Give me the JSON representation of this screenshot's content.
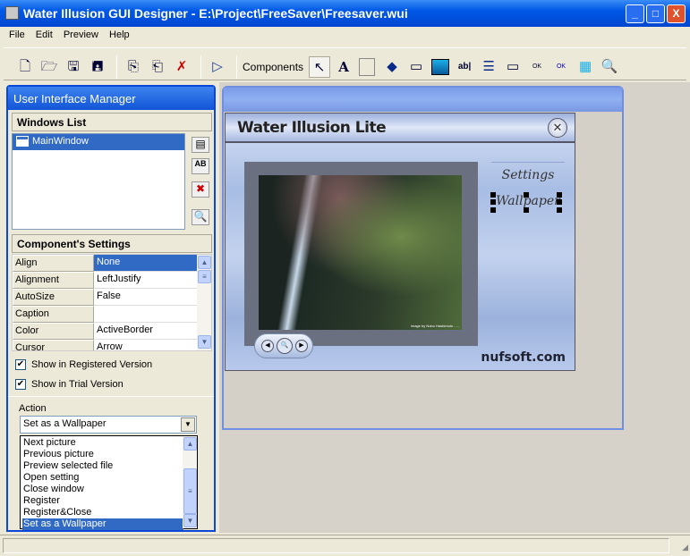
{
  "window": {
    "title": "Water Illusion GUI Designer - E:\\Project\\FreeSaver\\Freesaver.wui",
    "min": "_",
    "max": "□",
    "close": "X"
  },
  "menu": [
    "File",
    "Edit",
    "Preview",
    "Help"
  ],
  "toolbar": {
    "components_label": "Components"
  },
  "panel": {
    "title": "User Interface Manager",
    "windows_list_label": "Windows List",
    "windows": [
      "MainWindow"
    ],
    "settings_label": "Component's Settings",
    "properties": [
      {
        "name": "Align",
        "value": "None"
      },
      {
        "name": "Alignment",
        "value": "LeftJustify"
      },
      {
        "name": "AutoSize",
        "value": "False"
      },
      {
        "name": "Caption",
        "value": ""
      },
      {
        "name": "Color",
        "value": "ActiveBorder"
      },
      {
        "name": "Cursor",
        "value": "Arrow"
      }
    ],
    "show_registered": {
      "label": "Show in Registered Version",
      "checked": true
    },
    "show_trial": {
      "label": "Show in Trial Version",
      "checked": true
    },
    "action_label": "Action",
    "action_value": "Set as a Wallpaper",
    "action_options": [
      "Next picture",
      "Previous picture",
      "Preview selected file",
      "Open setting",
      "Close window",
      "Register",
      "Register&Close",
      "Set as a Wallpaper"
    ]
  },
  "preview": {
    "title": "Water Illusion Lite",
    "settings": "Settings",
    "wallpaper": "Wallpaper",
    "brand": "nufsoft.com",
    "photo_credit": "Image by Nobu Hashimoto - ..."
  },
  "colors": {
    "titlebar": "#0058e6",
    "selection": "#316ac5",
    "panel_border": "#0a46d8"
  }
}
